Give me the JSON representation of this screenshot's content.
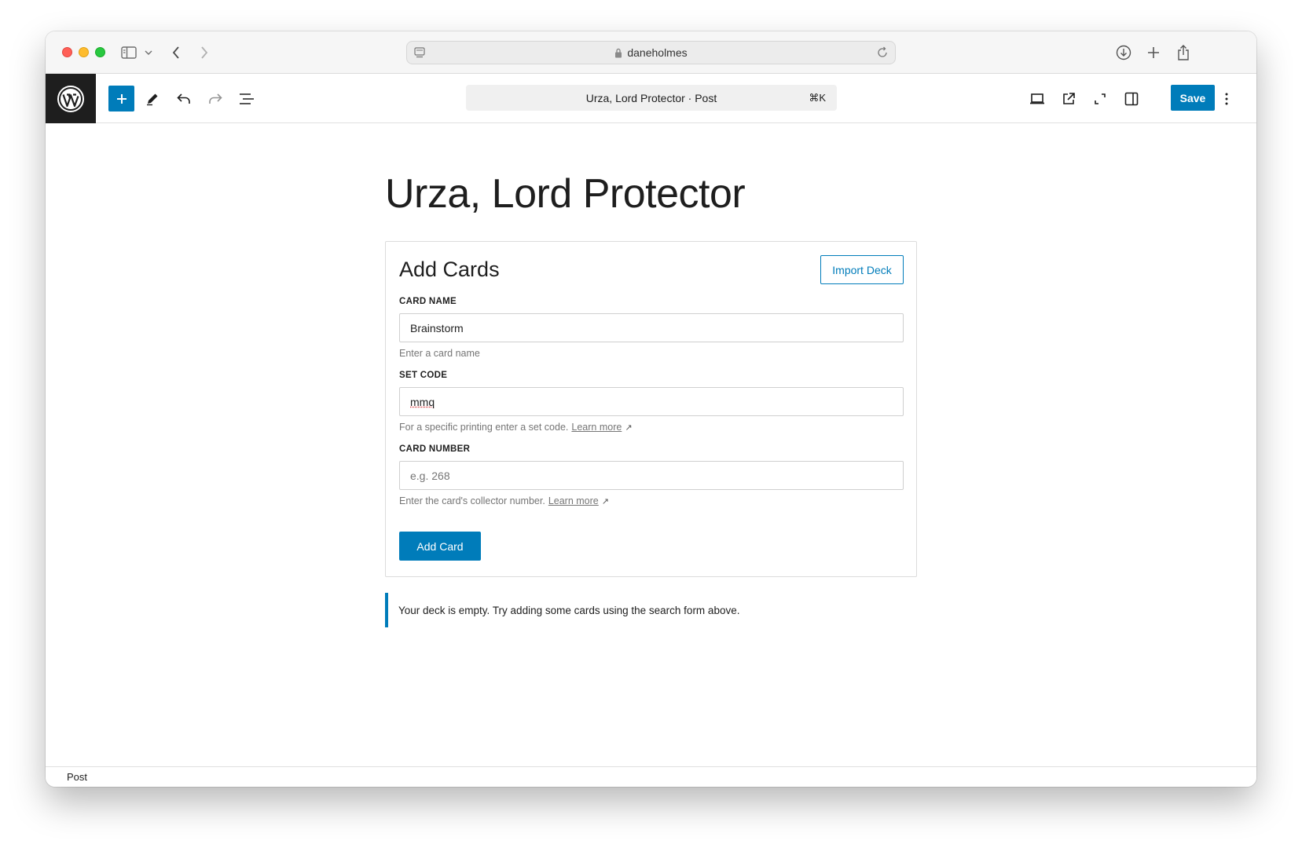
{
  "browser": {
    "address": "daneholmes"
  },
  "toolbar": {
    "document_title": "Urza, Lord Protector · Post",
    "shortcut": "⌘K",
    "save_label": "Save"
  },
  "post": {
    "title": "Urza, Lord Protector"
  },
  "block": {
    "heading": "Add Cards",
    "import_label": "Import Deck",
    "fields": [
      {
        "label": "CARD NAME",
        "value": "Brainstorm",
        "placeholder": "",
        "help": "Enter a card name"
      },
      {
        "label": "SET CODE",
        "value": "mmq",
        "placeholder": "",
        "help": "For a specific printing enter a set code.",
        "link": "Learn more"
      },
      {
        "label": "CARD NUMBER",
        "value": "",
        "placeholder": "e.g. 268",
        "help": "Enter the card's collector number.",
        "link": "Learn more"
      }
    ],
    "add_label": "Add Card"
  },
  "notice": {
    "text": "Your deck is empty. Try adding some cards using the search form above."
  },
  "footer": {
    "breadcrumb": "Post"
  },
  "colors": {
    "accent": "#007cba",
    "wp_dark": "#1e1e1e"
  }
}
